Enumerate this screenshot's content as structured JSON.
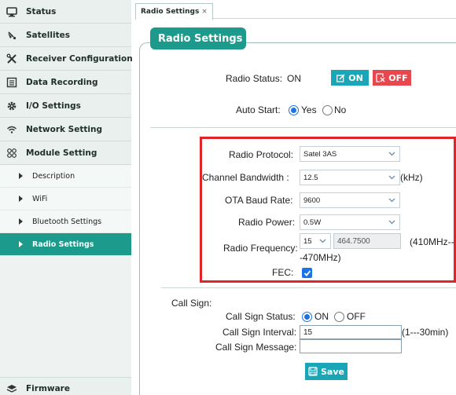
{
  "sidebar": {
    "items": [
      {
        "label": "Status",
        "icon": "monitor-icon"
      },
      {
        "label": "Satellites",
        "icon": "satellite-icon"
      },
      {
        "label": "Receiver Configuration",
        "icon": "tools-icon"
      },
      {
        "label": "Data Recording",
        "icon": "list-icon"
      },
      {
        "label": "I/O Settings",
        "icon": "gear-icon"
      },
      {
        "label": "Network Setting",
        "icon": "wifi-icon"
      },
      {
        "label": "Module Setting",
        "icon": "module-icon"
      }
    ],
    "subitems": [
      {
        "label": "Description"
      },
      {
        "label": "WiFi"
      },
      {
        "label": "Bluetooth Settings"
      },
      {
        "label": "Radio Settings",
        "active": true
      }
    ],
    "footer": {
      "label": "Firmware",
      "icon": "layers-icon"
    }
  },
  "tab": {
    "label": "Radio Settings",
    "close": "×"
  },
  "panel": {
    "title": "Radio Settings"
  },
  "radio_status": {
    "label": "Radio Status:",
    "value": "ON",
    "on_label": "ON",
    "off_label": "OFF"
  },
  "auto_start": {
    "label": "Auto Start:",
    "yes": "Yes",
    "no": "No",
    "selected": "Yes"
  },
  "protocol": {
    "label": "Radio Protocol:",
    "value": "Satel 3AS"
  },
  "bandwidth": {
    "label": "Channel Bandwidth :",
    "value": "12.5",
    "unit": "(kHz)"
  },
  "baud": {
    "label": "OTA Baud Rate:",
    "value": "9600"
  },
  "power": {
    "label": "Radio Power:",
    "value": "0.5W"
  },
  "frequency": {
    "label": "Radio Frequency:",
    "channel": "15",
    "value": "464.7500",
    "range_line1": "(410MHz--",
    "range_line2": "-470MHz)"
  },
  "fec": {
    "label": "FEC:",
    "checked": true
  },
  "call_sign": {
    "section_label": "Call Sign:",
    "status_label": "Call Sign Status:",
    "on": "ON",
    "off": "OFF",
    "selected": "ON",
    "interval_label": "Call Sign Interval:",
    "interval_value": "15",
    "interval_range": "(1---30min)",
    "message_label": "Call Sign Message:",
    "message_value": ""
  },
  "save_label": "Save",
  "colors": {
    "accent": "#1c9b8c",
    "on_button": "#1aa6b7",
    "off_button": "#e8484d",
    "highlight": "#e0242b",
    "checked": "#1a73e8"
  }
}
